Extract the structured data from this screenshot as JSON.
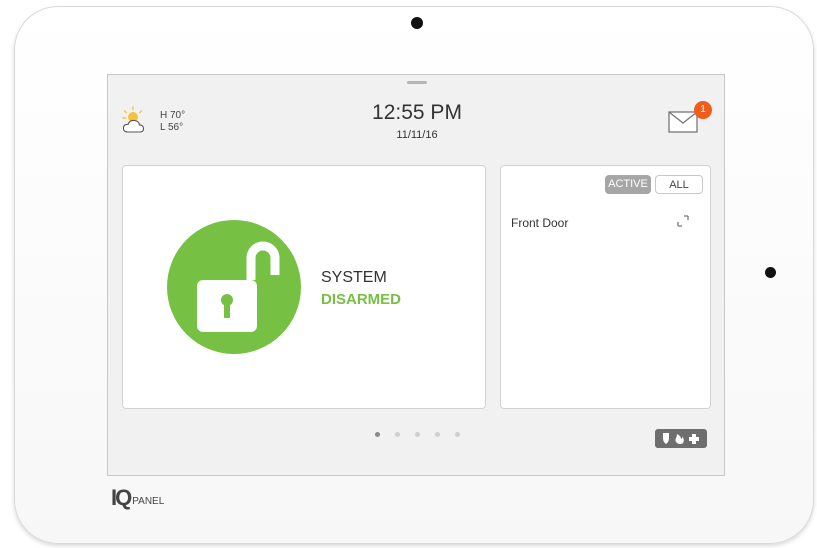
{
  "brand": {
    "logo_text": "IQ",
    "logo_sub": "PANEL"
  },
  "weather": {
    "icon": "partly-sunny-icon",
    "high": "H 70°",
    "low": "L 56°"
  },
  "clock": {
    "time": "12:55 PM",
    "date": "11/11/16"
  },
  "messages": {
    "icon": "envelope-icon",
    "badge_count": "1"
  },
  "system_status": {
    "line1": "SYSTEM",
    "line2": "DISARMED",
    "icon": "unlocked-padlock-icon",
    "accent_color": "#76c043"
  },
  "sensors": {
    "tabs": [
      {
        "label": "ACTIVE",
        "selected": true
      },
      {
        "label": "ALL",
        "selected": false
      }
    ],
    "items": [
      {
        "name": "Front Door",
        "icon": "open-link-icon"
      }
    ]
  },
  "pager": {
    "total_pages": 5,
    "current_page": 1
  },
  "emergency": {
    "icons": [
      "shield-icon",
      "fire-icon",
      "medical-cross-icon"
    ]
  },
  "colors": {
    "badge": "#f25c1b",
    "tab_active_bg": "#a6a6a6",
    "emergency_bg": "#6e6e6e"
  }
}
